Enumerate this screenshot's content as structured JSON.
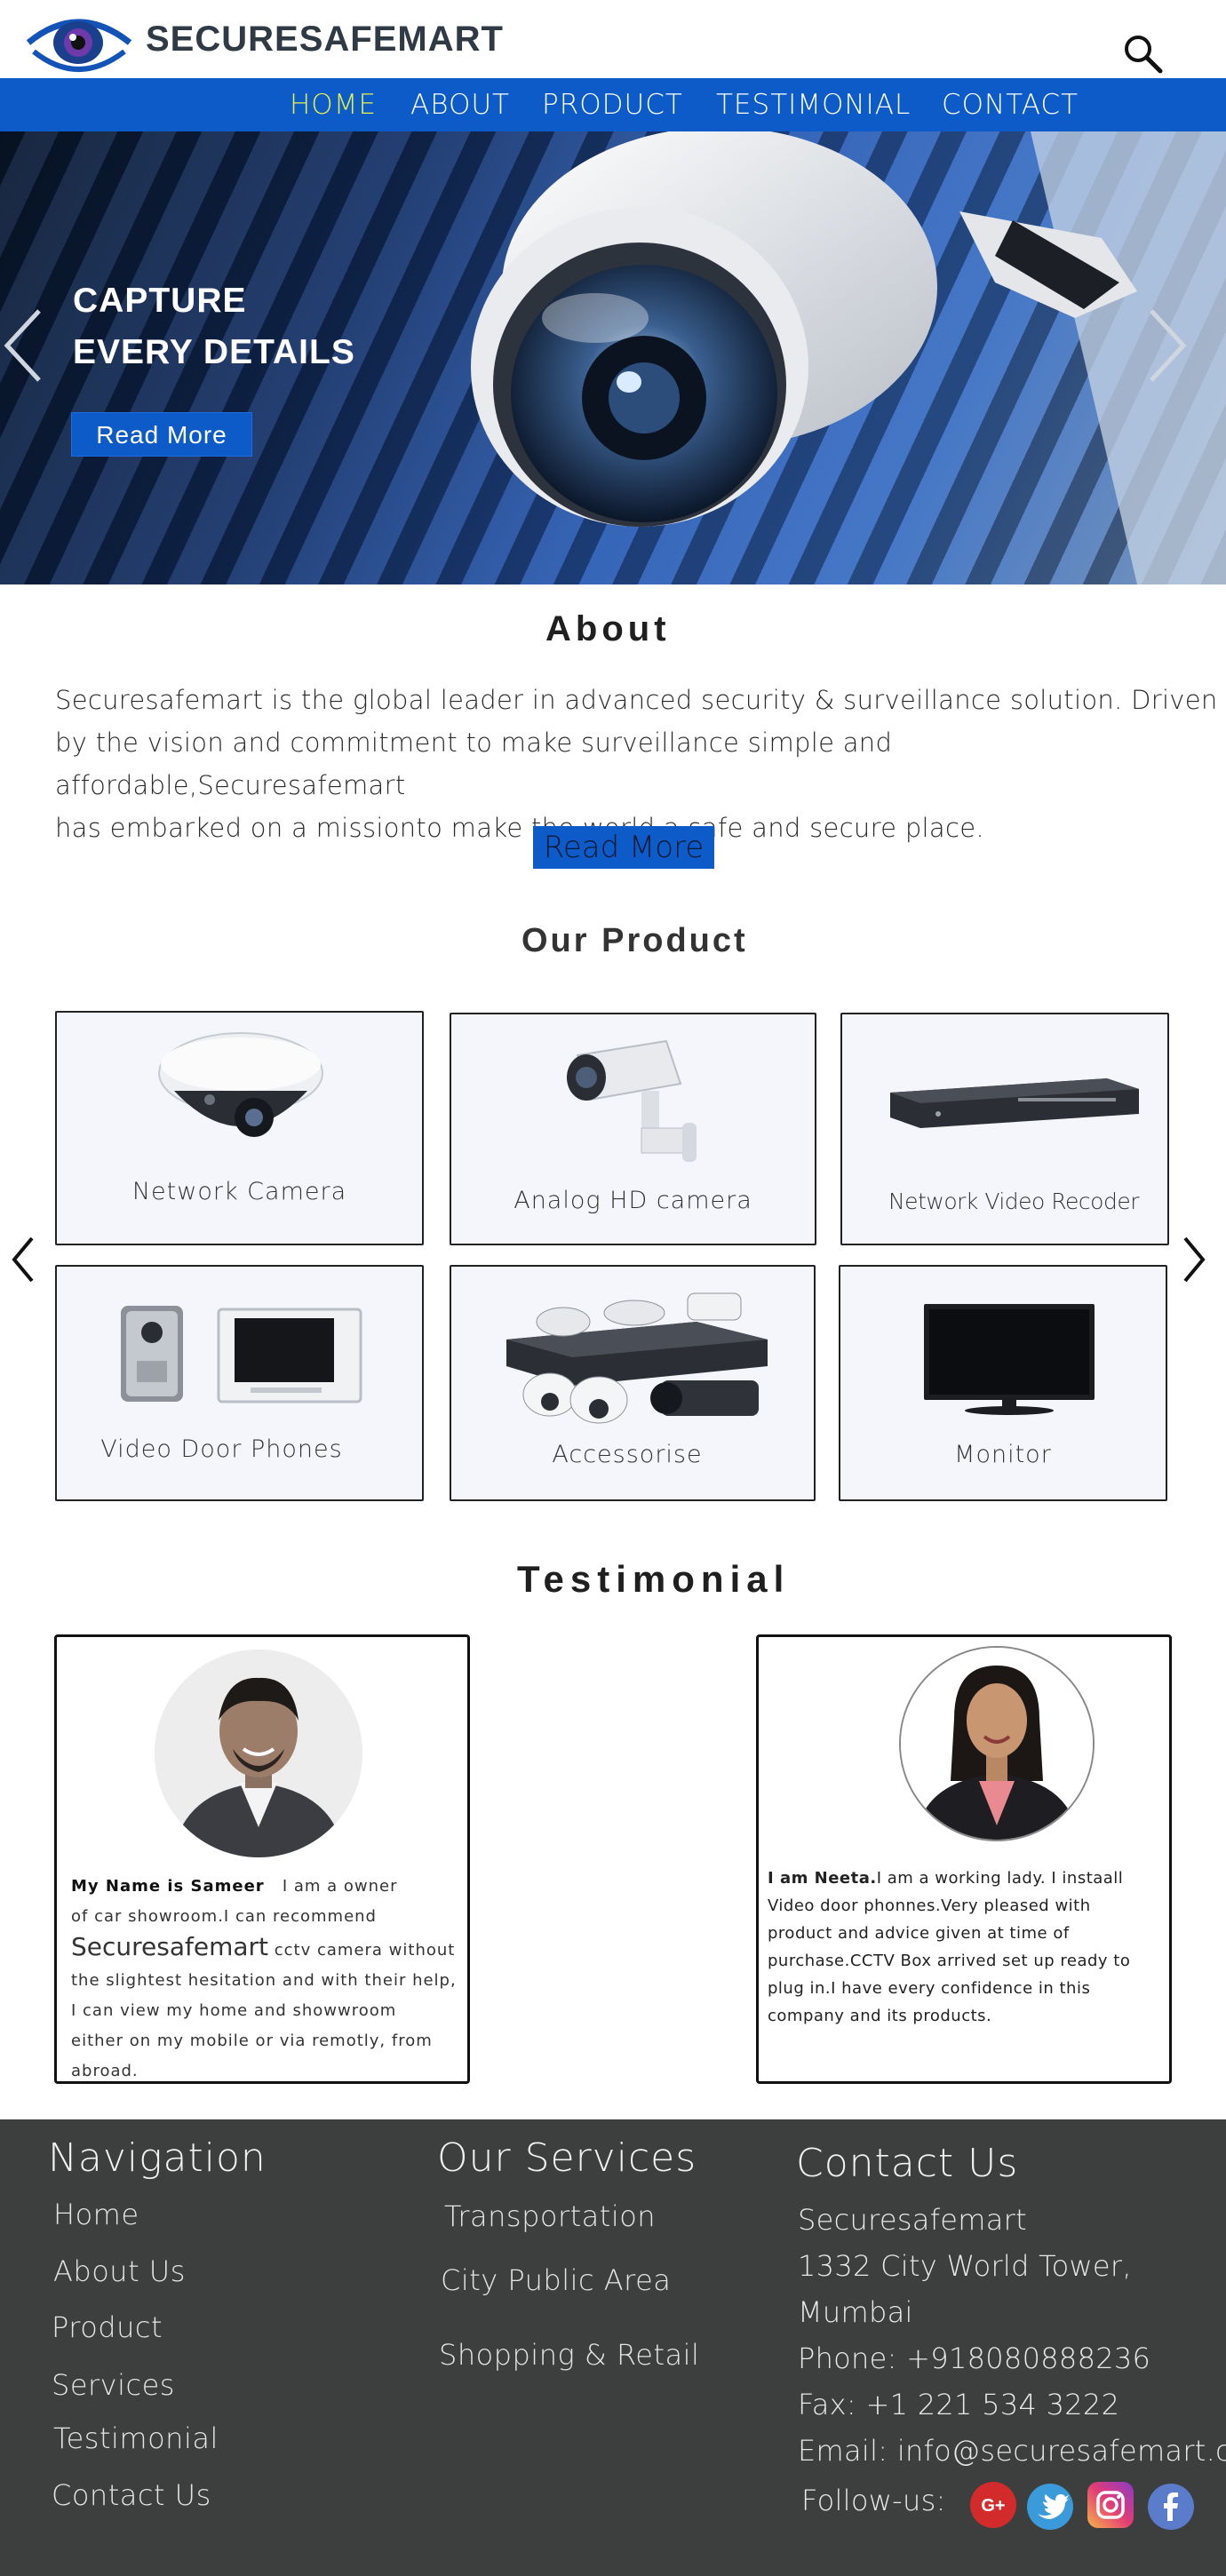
{
  "brand": {
    "name": "SECURESAFEMART",
    "logo_icon": "eye-logo-icon"
  },
  "nav": {
    "items": [
      {
        "label": "HOME",
        "active": true
      },
      {
        "label": "ABOUT",
        "active": false
      },
      {
        "label": "PRODUCT",
        "active": false
      },
      {
        "label": "TESTIMONIAL",
        "active": false
      },
      {
        "label": "CONTACT",
        "active": false
      }
    ],
    "active_color": "#e6f04a",
    "bar_color": "#0c5bc9"
  },
  "hero": {
    "line1": "CAPTURE",
    "line2": "EVERY DETAILS",
    "button": "Read More"
  },
  "about": {
    "title": "About",
    "line1": "Securesafemart is the global leader in advanced security & surveillance solution. Driven",
    "line2": "by the vision and commitment to make surveillance simple and affordable,Securesafemart",
    "line3": "has embarked on a missionto make the world a safe and secure place.",
    "button": "Read More"
  },
  "products": {
    "title": "Our Product",
    "items": [
      {
        "label": "Network Camera",
        "icon": "dome-camera-icon"
      },
      {
        "label": "Analog HD camera",
        "icon": "bullet-camera-icon"
      },
      {
        "label": "Network Video Recoder",
        "icon": "nvr-icon"
      },
      {
        "label": "Video Door Phones",
        "icon": "door-phone-icon"
      },
      {
        "label": "Accessorise",
        "icon": "accessories-icon"
      },
      {
        "label": "Monitor",
        "icon": "monitor-icon"
      }
    ]
  },
  "testimonial": {
    "title": "Testimonial",
    "sameer": {
      "name_intro": "My Name is Sameer",
      "l1": "I am a owner",
      "l2": "of car showroom.I can recommend",
      "brand": "Securesafemart",
      "l3": "cctv camera  without",
      "l4": "the slightest hesitation and with their help,",
      "l5": "I can view my home and showwroom",
      "l6": "either on my mobile or via remotly, from",
      "l7": "abroad."
    },
    "neeta": {
      "name_intro": "I am Neeta.",
      "l1": "I am a working lady. I instaall",
      "l2": "Video door phonnes.Very pleased with",
      "l3": "product and advice given at time of",
      "l4": "purchase.CCTV Box arrived set up ready to",
      "l5": "plug in.I have every confidence in this",
      "l6": "company and its products."
    }
  },
  "footer": {
    "navigation": {
      "title": "Navigation",
      "links": [
        "Home",
        "About Us",
        "Product",
        "Services",
        "Testimonial",
        "Contact Us"
      ]
    },
    "services": {
      "title": "Our Services",
      "links": [
        "Transportation",
        "City Public Area",
        "Shopping & Retail"
      ]
    },
    "contact": {
      "title": "Contact Us",
      "company": "Securesafemart",
      "address1": "1332 City World Tower,",
      "address2": "Mumbai",
      "phone": "Phone: +918080888236",
      "fax": "Fax: +1 221 534 3222",
      "email": "Email: info@securesafemart.com",
      "follow": "Follow-us:",
      "social": [
        "google-plus-icon",
        "twitter-icon",
        "instagram-icon",
        "facebook-icon"
      ]
    },
    "bg_color": "#3c3f3d"
  }
}
